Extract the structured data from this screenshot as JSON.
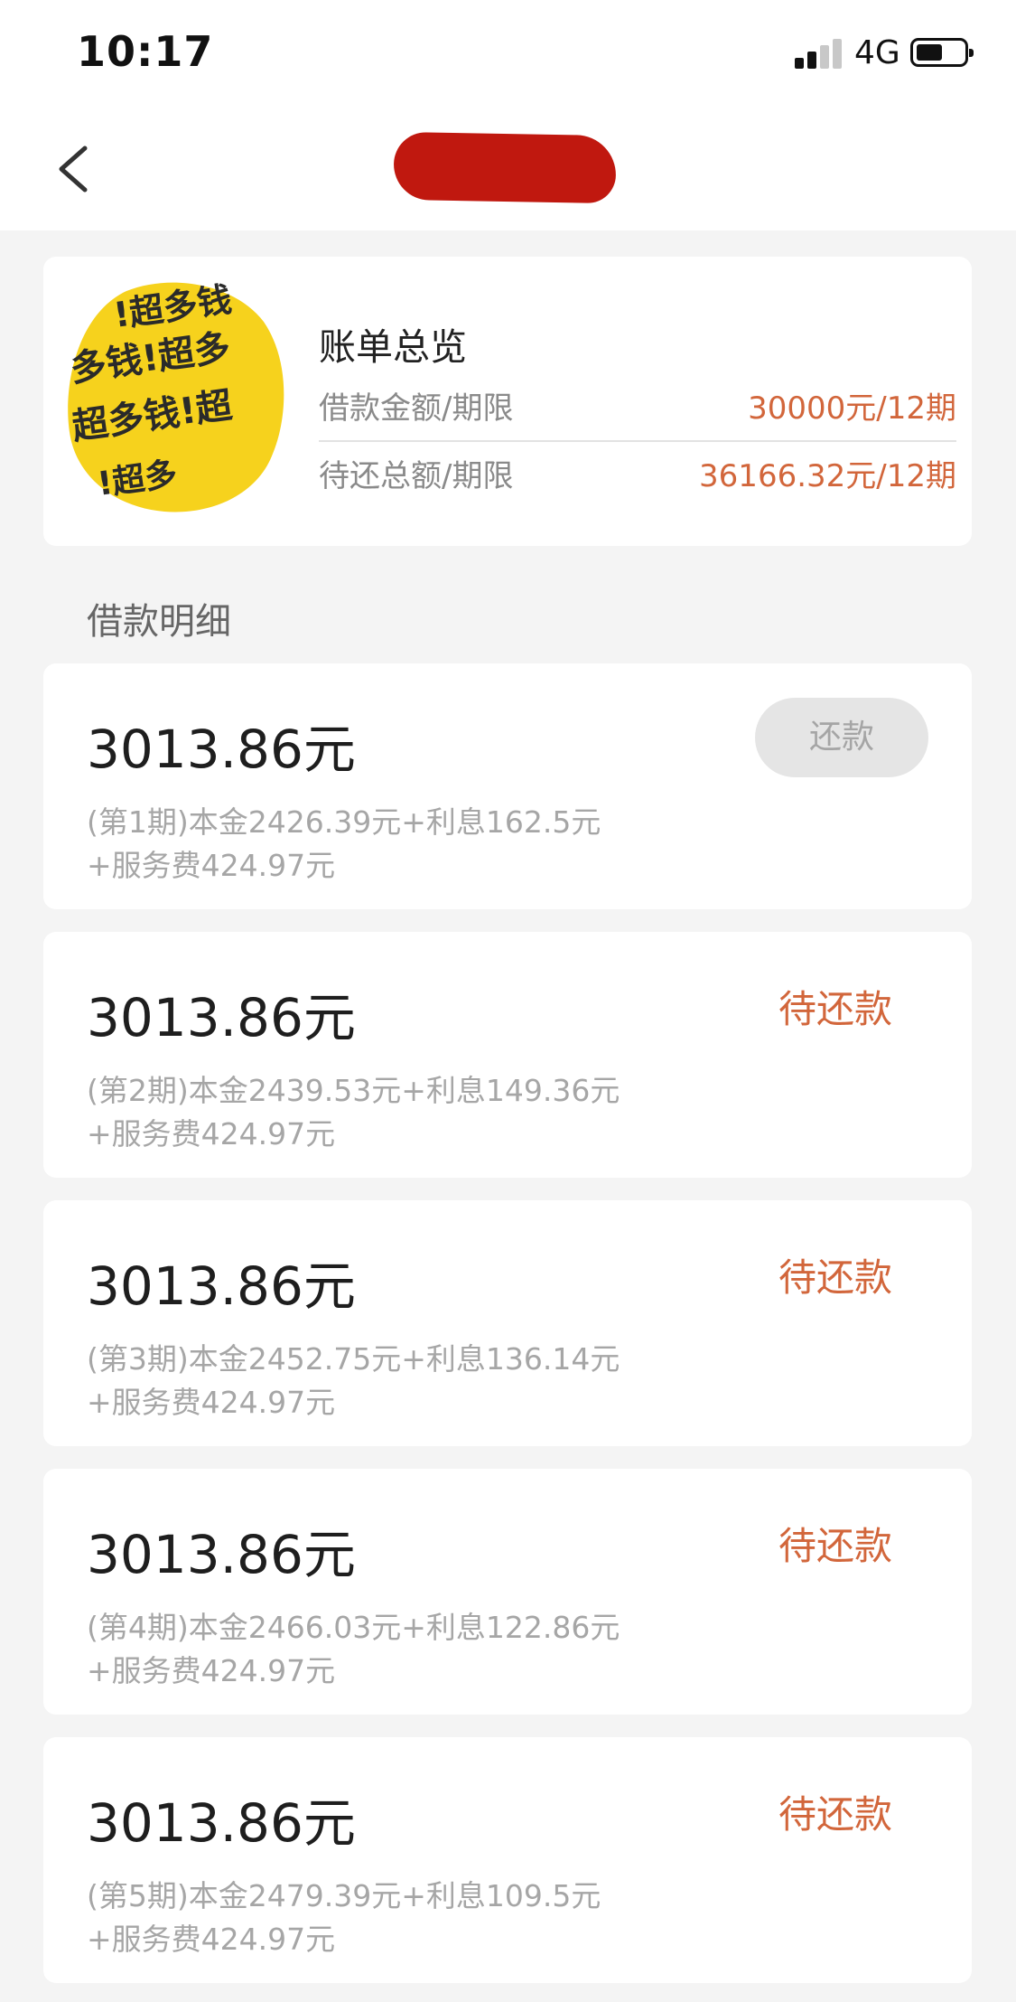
{
  "status_bar": {
    "time": "10:17",
    "network": "4G",
    "icons": [
      "signal-icon",
      "battery-icon"
    ]
  },
  "nav": {
    "back_icon": "chevron-left-icon",
    "title_redacted": true
  },
  "overview": {
    "title": "账单总览",
    "rows": [
      {
        "label": "借款金额/期限",
        "value": "30000元/12期"
      },
      {
        "label": "待还总额/期限",
        "value": "36166.32元/12期"
      }
    ]
  },
  "section_title": "借款明细",
  "installments": [
    {
      "amount": "3013.86元",
      "line1": "(第1期)本金2426.39元+利息162.5元",
      "line2": "+服务费424.97元",
      "action": "还款",
      "action_type": "button_disabled"
    },
    {
      "amount": "3013.86元",
      "line1": "(第2期)本金2439.53元+利息149.36元",
      "line2": "+服务费424.97元",
      "action": "待还款",
      "action_type": "status"
    },
    {
      "amount": "3013.86元",
      "line1": "(第3期)本金2452.75元+利息136.14元",
      "line2": "+服务费424.97元",
      "action": "待还款",
      "action_type": "status"
    },
    {
      "amount": "3013.86元",
      "line1": "(第4期)本金2466.03元+利息122.86元",
      "line2": "+服务费424.97元",
      "action": "待还款",
      "action_type": "status"
    },
    {
      "amount": "3013.86元",
      "line1": "(第5期)本金2479.39元+利息109.5元",
      "line2": "+服务费424.97元",
      "action": "待还款",
      "action_type": "status"
    }
  ],
  "colors": {
    "accent": "#d2663b",
    "background": "#f4f4f4",
    "card": "#ffffff",
    "redaction": "#c0180f",
    "logo_yellow": "#f6d21d"
  }
}
